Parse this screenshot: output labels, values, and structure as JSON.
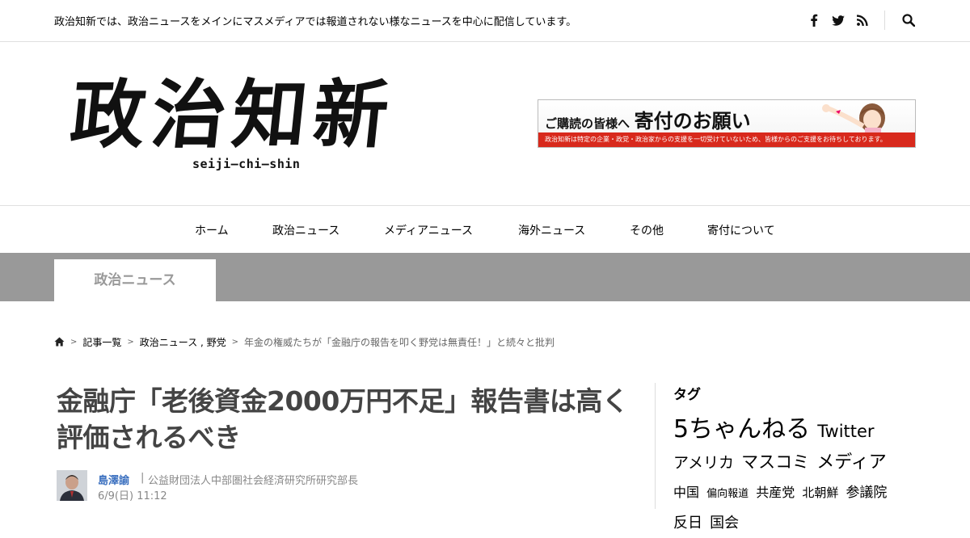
{
  "tagline": "政治知新では、政治ニュースをメインにマスメディアでは報道されない様なニュースを中心に配信しています。",
  "social_icons": [
    "facebook-icon",
    "twitter-icon",
    "rss-icon",
    "search-icon"
  ],
  "logo": {
    "kanji": "政治知新",
    "roman": "seiji–chi–shin"
  },
  "banner": {
    "lead": "ご購読の皆様へ",
    "main": "寄付のお願い",
    "strip": "政治知新は特定の企業・政党・政治家からの支援を一切受けていないため、皆様からのご支援をお待ちしております。"
  },
  "nav": {
    "items": [
      {
        "label": "ホーム"
      },
      {
        "label": "政治ニュース"
      },
      {
        "label": "メディアニュース"
      },
      {
        "label": "海外ニュース"
      },
      {
        "label": "その他"
      },
      {
        "label": "寄付について"
      }
    ]
  },
  "category_tab": "政治ニュース",
  "breadcrumb": {
    "home_icon": "home-icon",
    "items": [
      "記事一覧",
      "政治ニュース , 野党"
    ],
    "current": "年金の権威たちが「金融庁の報告を叩く野党は無責任！」と続々と批判"
  },
  "article": {
    "title": "金融庁「老後資金2000万円不足」報告書は高く評価されるべき",
    "author": {
      "name": "島澤諭",
      "separator": "|",
      "organization": "公益財団法人中部圏社会経済研究所研究部長",
      "date": "6/9(日) 11:12"
    }
  },
  "sidebar": {
    "heading": "タグ",
    "tags": [
      {
        "label": "5ちゃんねる",
        "size": 30
      },
      {
        "label": "Twitter",
        "size": 21
      },
      {
        "label": "アメリカ",
        "size": 19
      },
      {
        "label": "マスコミ",
        "size": 21
      },
      {
        "label": "メディア",
        "size": 22
      },
      {
        "label": "中国",
        "size": 16
      },
      {
        "label": "偏向報道",
        "size": 13
      },
      {
        "label": "共産党",
        "size": 16
      },
      {
        "label": "北朝鮮",
        "size": 15
      },
      {
        "label": "参議院",
        "size": 17
      },
      {
        "label": "反日",
        "size": 18
      },
      {
        "label": "国会",
        "size": 18
      }
    ]
  }
}
